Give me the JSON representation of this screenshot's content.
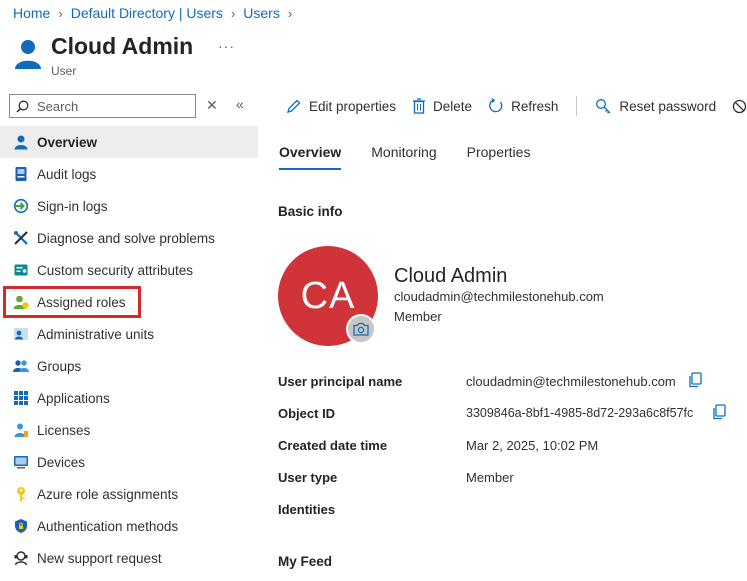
{
  "breadcrumb": [
    "Home",
    "Default Directory | Users",
    "Users"
  ],
  "header": {
    "title": "Cloud Admin",
    "subtitle": "User",
    "more": "···"
  },
  "search": {
    "placeholder": "Search",
    "value": ""
  },
  "sidebar": {
    "items": [
      {
        "label": "Overview",
        "icon": "user-icon",
        "active": true
      },
      {
        "label": "Audit logs",
        "icon": "audit-log-icon"
      },
      {
        "label": "Sign-in logs",
        "icon": "sign-in-icon"
      },
      {
        "label": "Diagnose and solve problems",
        "icon": "wrench-icon"
      },
      {
        "label": "Custom security attributes",
        "icon": "attributes-icon"
      },
      {
        "label": "Assigned roles",
        "icon": "roles-icon"
      },
      {
        "label": "Administrative units",
        "icon": "admin-units-icon"
      },
      {
        "label": "Groups",
        "icon": "groups-icon"
      },
      {
        "label": "Applications",
        "icon": "apps-grid-icon"
      },
      {
        "label": "Licenses",
        "icon": "license-icon"
      },
      {
        "label": "Devices",
        "icon": "device-icon"
      },
      {
        "label": "Azure role assignments",
        "icon": "key-icon"
      },
      {
        "label": "Authentication methods",
        "icon": "shield-icon"
      },
      {
        "label": "New support request",
        "icon": "support-icon"
      }
    ]
  },
  "toolbar": {
    "edit": "Edit properties",
    "delete": "Delete",
    "refresh": "Refresh",
    "reset_password": "Reset password",
    "truncated": "R"
  },
  "tabs": [
    "Overview",
    "Monitoring",
    "Properties"
  ],
  "basic_info": {
    "title": "Basic info",
    "initials": "CA",
    "name": "Cloud Admin",
    "email": "cloudadmin@techmilestonehub.com",
    "user_type": "Member"
  },
  "properties": [
    {
      "label": "User principal name",
      "value": "cloudadmin@techmilestonehub.com"
    },
    {
      "label": "Object ID",
      "value": "3309846a-8bf1-4985-8d72-293a6c8f57fc"
    },
    {
      "label": "Created date time",
      "value": "Mar 2, 2025, 10:02 PM"
    },
    {
      "label": "User type",
      "value": "Member"
    },
    {
      "label": "Identities",
      "value": ""
    }
  ],
  "my_feed": {
    "title": "My Feed"
  },
  "colors": {
    "accent": "#0f6cbd",
    "avatar": "#d13438",
    "highlight": "#d42a2a"
  }
}
